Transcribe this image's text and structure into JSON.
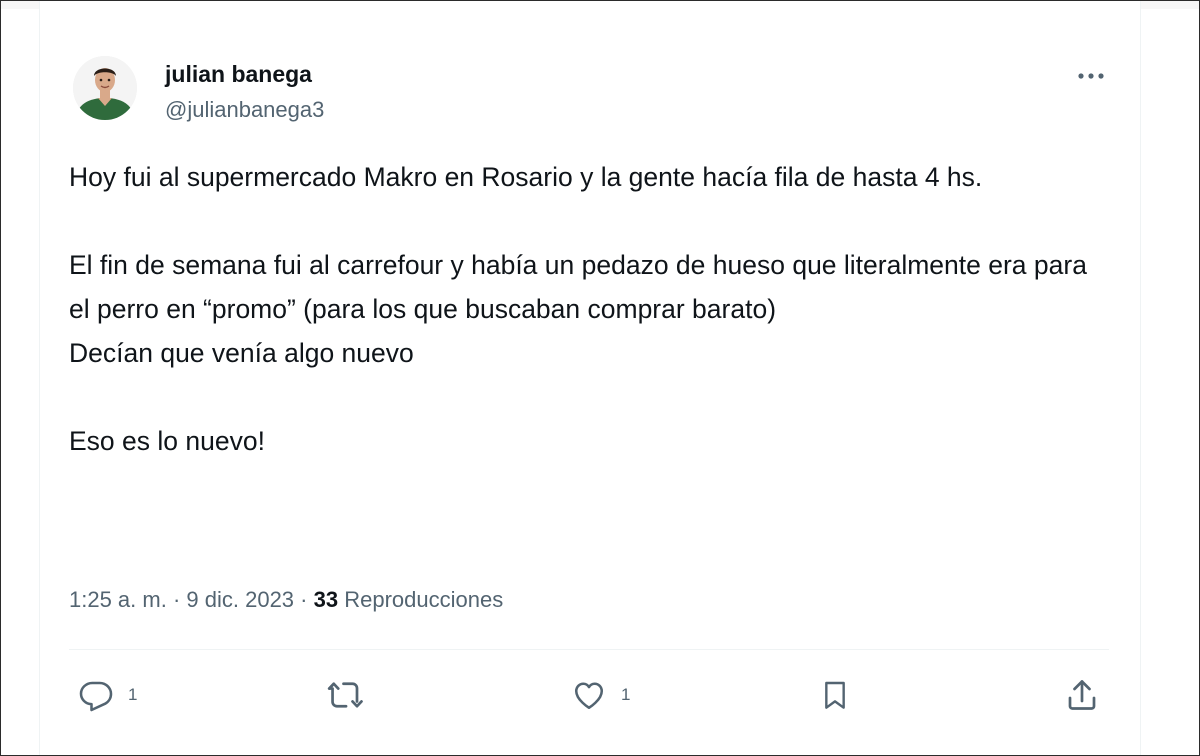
{
  "author": {
    "name": "julian banega",
    "handle": "@julianbanega3",
    "avatar": "avatar-photo"
  },
  "tweet": {
    "paragraphs": [
      "Hoy fui al supermercado Makro en Rosario y la gente hacía fila de hasta 4 hs.",
      "",
      "El fin de semana fui al carrefour y había un pedazo de hueso que literalmente era para el perro en “promo” (para los que buscaban comprar barato)",
      "Decían que venía algo nuevo",
      "",
      "Eso es lo nuevo!"
    ]
  },
  "meta": {
    "time": "1:25 a. m.",
    "sep1": " · ",
    "date": "9 dic. 2023",
    "sep2": " · ",
    "views_count": "33",
    "views_label": " Reproducciones"
  },
  "actions": {
    "reply_count": "1",
    "like_count": "1"
  },
  "icons": {
    "more": "more-horizontal-icon",
    "reply": "reply-icon",
    "retweet": "retweet-icon",
    "like": "heart-icon",
    "bookmark": "bookmark-icon",
    "share": "share-icon"
  },
  "colors": {
    "text": "#0f1419",
    "secondary": "#536471",
    "border": "#eff3f4",
    "avatar_shirt": "#2f6b3c"
  }
}
